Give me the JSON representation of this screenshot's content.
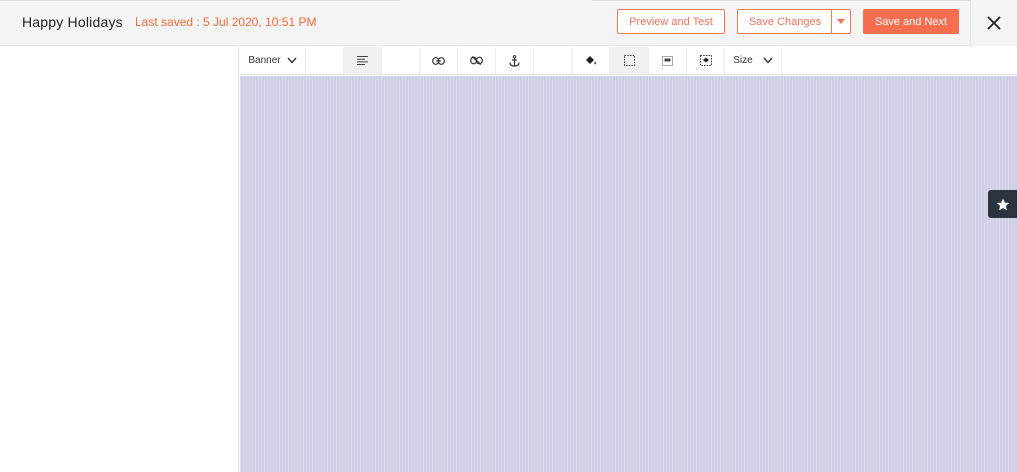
{
  "header": {
    "title": "Happy Holidays",
    "last_saved": "Last saved : 5 Jul 2020, 10:51 PM",
    "preview_label": "Preview and Test",
    "save_label": "Save Changes",
    "save_next_label": "Save and Next"
  },
  "toolbar": {
    "block_type": "Banner",
    "size_label": "Size",
    "icons": [
      "align-left-icon",
      "link-icon",
      "unlink-icon",
      "anchor-icon",
      "paint-bucket-icon",
      "border-icon",
      "padding-icon",
      "selection-fill-icon"
    ]
  },
  "colors": {
    "accent": "#f66e4f",
    "last_saved_text": "#f26a36",
    "canvas": "#cfd0e6",
    "fav_tab": "#2a3340"
  }
}
